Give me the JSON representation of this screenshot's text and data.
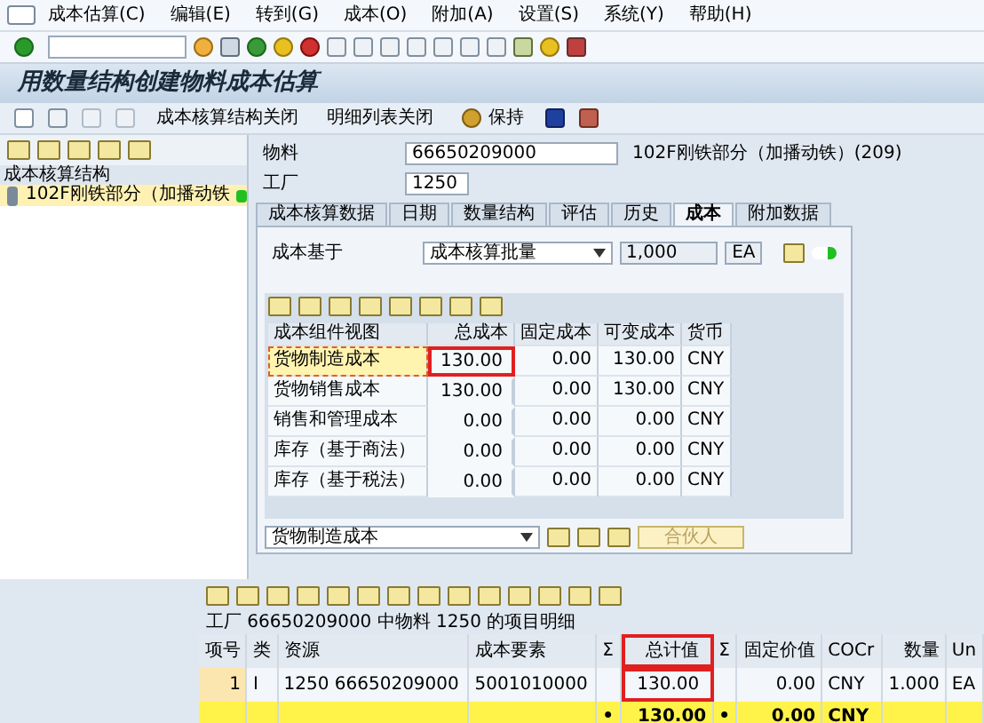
{
  "menu": [
    "成本估算(C)",
    "编辑(E)",
    "转到(G)",
    "成本(O)",
    "附加(A)",
    "设置(S)",
    "系统(Y)",
    "帮助(H)"
  ],
  "title": "用数量结构创建物料成本估算",
  "app_toolbar": [
    "成本核算结构关闭",
    "明细列表关闭",
    "保持"
  ],
  "tree": {
    "header": "成本核算结构",
    "items": [
      {
        "label": "102F刚铁部分（加播动铁",
        "selected": true
      }
    ]
  },
  "header_fields": [
    {
      "label": "物料",
      "value": "66650209000",
      "description": "102F刚铁部分（加播动铁）(209)"
    },
    {
      "label": "工厂",
      "value": "1250"
    }
  ],
  "tabs": [
    {
      "label": "成本核算数据",
      "selected": false
    },
    {
      "label": "日期",
      "selected": false
    },
    {
      "label": "数量结构",
      "selected": false
    },
    {
      "label": "评估",
      "selected": false
    },
    {
      "label": "历史",
      "selected": false
    },
    {
      "label": "成本",
      "selected": true
    },
    {
      "label": "附加数据",
      "selected": false
    }
  ],
  "cost_basis": {
    "label": "成本基于",
    "value": "成本核算批量",
    "quantity": "1,000",
    "unit": "EA"
  },
  "component_grid": {
    "columns": [
      "成本组件视图",
      "总成本",
      "固定成本",
      "可变成本",
      "货币"
    ],
    "rows": [
      {
        "cells": [
          "货物制造成本",
          "130.00",
          "0.00",
          "130.00",
          "CNY"
        ],
        "selected": true,
        "highlighted": true
      },
      {
        "cells": [
          "货物销售成本",
          "130.00",
          "0.00",
          "130.00",
          "CNY"
        ],
        "selected": false,
        "highlighted": false
      },
      {
        "cells": [
          "销售和管理成本",
          "0.00",
          "0.00",
          "0.00",
          "CNY"
        ],
        "selected": false,
        "highlighted": false
      },
      {
        "cells": [
          "库存（基于商法）",
          "0.00",
          "0.00",
          "0.00",
          "CNY"
        ],
        "selected": false,
        "highlighted": false
      },
      {
        "cells": [
          "库存（基于税法）",
          "0.00",
          "0.00",
          "0.00",
          "CNY"
        ],
        "selected": false,
        "highlighted": false
      }
    ]
  },
  "view_select": {
    "value": "货物制造成本",
    "partner_button": "合伙人",
    "partner_disabled": true
  },
  "itemization": {
    "caption": "工厂 66650209000 中物料 1250 的项目明细",
    "columns": [
      {
        "label": "项号",
        "highlighted": false
      },
      {
        "label": "类",
        "highlighted": false
      },
      {
        "label": "资源",
        "highlighted": false
      },
      {
        "label": "成本要素",
        "highlighted": false
      },
      {
        "label": "Σ",
        "highlighted": false
      },
      {
        "label": "总计值",
        "highlighted": true
      },
      {
        "label": "Σ",
        "highlighted": false
      },
      {
        "label": "固定价值",
        "highlighted": false
      },
      {
        "label": "COCr",
        "highlighted": false
      },
      {
        "label": "数量",
        "highlighted": false
      },
      {
        "label": "Un",
        "highlighted": false
      }
    ],
    "rows": [
      {
        "kind": "item",
        "cells": [
          "1",
          "I",
          "1250 66650209000",
          "5001010000",
          "",
          "130.00",
          "",
          "0.00",
          "CNY",
          "1.000",
          "EA"
        ]
      },
      {
        "kind": "total",
        "cells": [
          "",
          "",
          "",
          "",
          "•",
          "130.00",
          "•",
          "0.00",
          "CNY",
          "",
          ""
        ]
      }
    ]
  }
}
